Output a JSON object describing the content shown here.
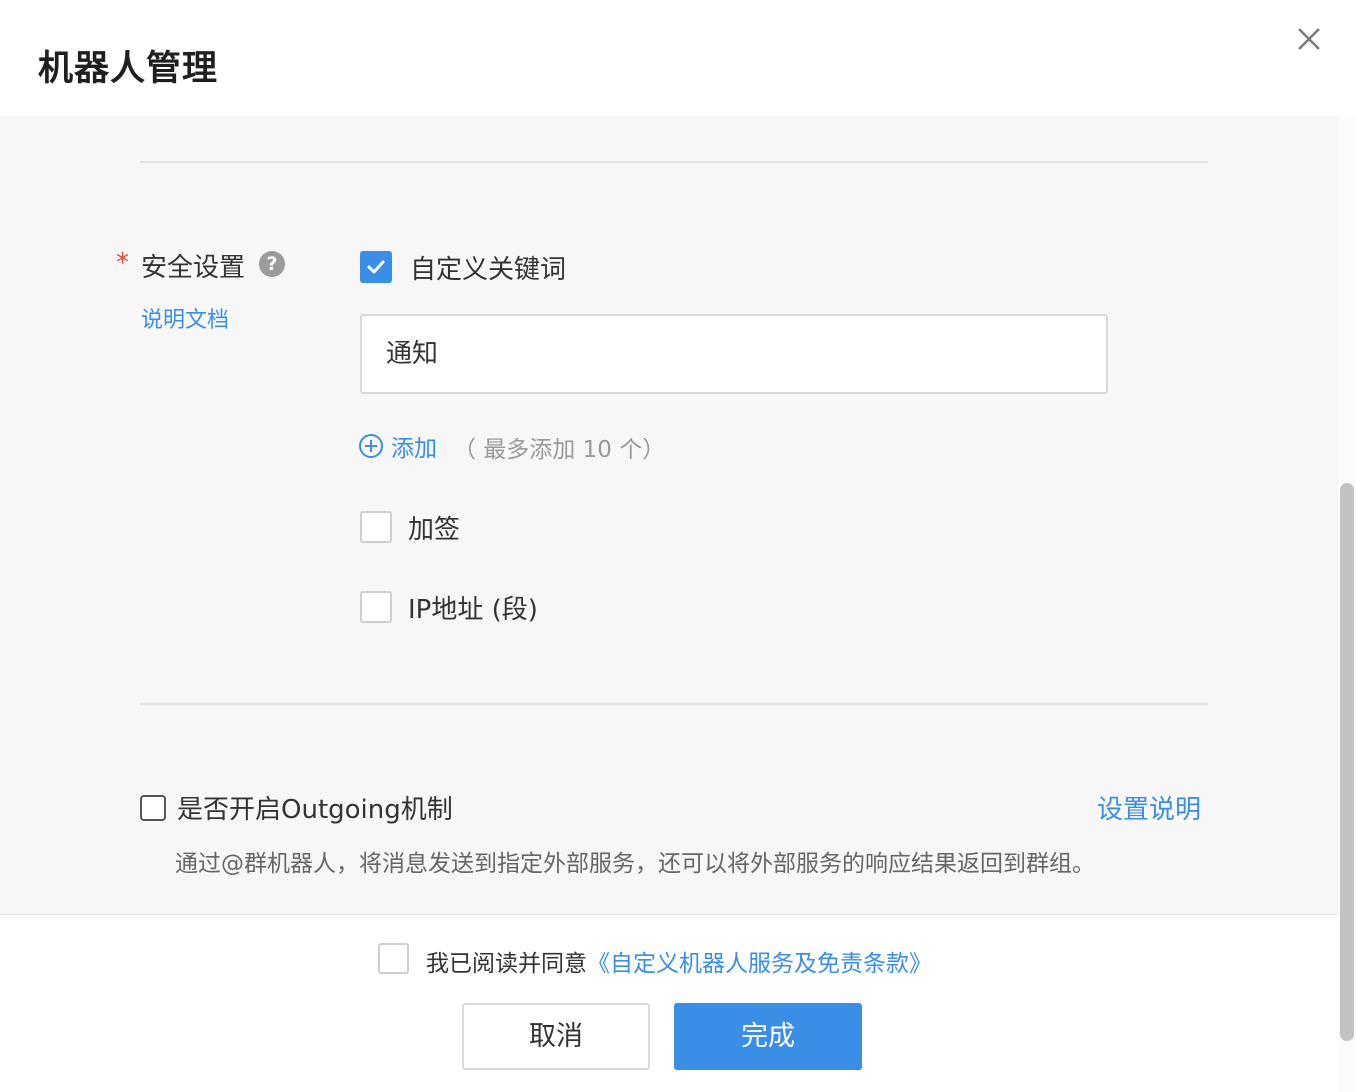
{
  "dialog": {
    "title": "机器人管理"
  },
  "security": {
    "required_mark": "*",
    "label": "安全设置",
    "help_glyph": "?",
    "doc_link": "说明文档",
    "custom_keyword": {
      "label": "自定义关键词",
      "checked": true
    },
    "keyword_value": "通知",
    "add_label": "添加",
    "add_hint": "（ 最多添加 10 个）",
    "sign": {
      "label": "加签",
      "checked": false
    },
    "ip": {
      "label": "IP地址 (段)",
      "checked": false
    }
  },
  "outgoing": {
    "label": "是否开启Outgoing机制",
    "checked": false,
    "setting_link": "设置说明",
    "description": "通过@群机器人，将消息发送到指定外部服务，还可以将外部服务的响应结果返回到群组。"
  },
  "footer": {
    "agree_prefix": "我已阅读并同意",
    "agree_link": "《自定义机器人服务及免责条款》",
    "agree_checked": false,
    "cancel_label": "取消",
    "done_label": "完成"
  },
  "colors": {
    "accent": "#3a8ee6",
    "required": "#e64a3c",
    "panel_bg": "#f7f7f7"
  }
}
